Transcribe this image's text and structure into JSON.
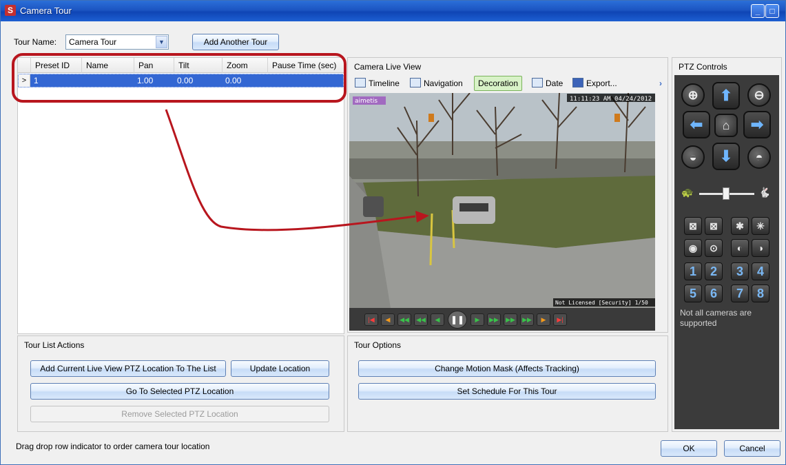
{
  "window": {
    "title": "Camera Tour",
    "app_icon": "S"
  },
  "tour": {
    "name_label": "Tour Name:",
    "name_value": "Camera Tour",
    "add_button": "Add Another Tour"
  },
  "grid": {
    "columns": [
      "Preset ID",
      "Name",
      "Pan",
      "Tilt",
      "Zoom",
      "Pause Time (sec)"
    ],
    "rows": [
      {
        "indicator": ">",
        "preset_id": "1",
        "name": "",
        "pan": "1.00",
        "tilt": "0.00",
        "zoom": "0.00",
        "pause": ""
      }
    ]
  },
  "live_view": {
    "title": "Camera Live View",
    "toolbar": {
      "timeline": "Timeline",
      "navigation": "Navigation",
      "decoration": "Decoration",
      "date": "Date",
      "export": "Export...",
      "more": "›"
    },
    "overlay_logo": "aimetis",
    "overlay_time": "11:11:23 AM 04/24/2012",
    "overlay_footer": "Not Licensed [Security] 1/50"
  },
  "ptz": {
    "title": "PTZ Controls",
    "numbers": [
      "1",
      "2",
      "3",
      "4",
      "5",
      "6",
      "7",
      "8"
    ],
    "note": "Not all cameras are supported"
  },
  "tour_list_actions": {
    "title": "Tour List Actions",
    "add_current": "Add Current Live View PTZ Location To The List",
    "update": "Update Location",
    "go_to": "Go To Selected PTZ Location",
    "remove": "Remove Selected PTZ Location"
  },
  "tour_options": {
    "title": "Tour Options",
    "change_mask": "Change Motion Mask (Affects Tracking)",
    "schedule": "Set Schedule For This Tour"
  },
  "footer": {
    "hint": "Drag  drop row indicator to order camera tour location",
    "ok": "OK",
    "cancel": "Cancel"
  },
  "colors": {
    "selection": "#3367d3",
    "annotation": "#b8161e",
    "titlebar": "#1c55c2"
  }
}
